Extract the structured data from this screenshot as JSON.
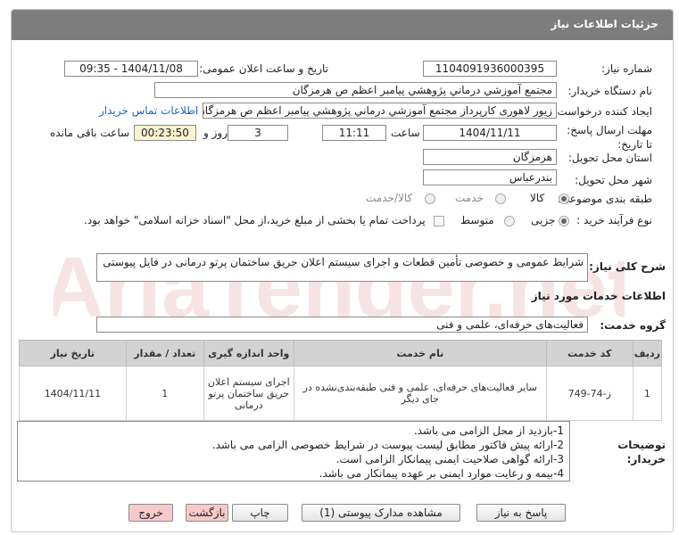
{
  "page_title": "جزئیات اطلاعات نیاز",
  "fields": {
    "need_number_label": "شماره نیاز:",
    "need_number": "1104091936000395",
    "announce_label": "تاریخ و ساعت اعلان عمومی:",
    "announce_value": "1404/11/08 - 09:35",
    "buyer_org_label": "نام دستگاه خریدار:",
    "buyer_org": "مجتمع آموزشي درماني پژوهشي پيامبر اعظم ص  هرمزگان",
    "requester_label": "ایجاد کننده درخواست:",
    "requester": "زیور لاهوری کارپرداز مجتمع آموزشي درماني پژوهشي پيامبر اعظم ص  هرمزگان",
    "contact_link": "اطلاعات تماس خریدار",
    "deadline_label": "مهلت ارسال پاسخ: تا تاریخ:",
    "deadline_date": "1404/11/11",
    "time_label": "ساعت",
    "deadline_time": "11:11",
    "days_value": "3",
    "days_label": "روز و",
    "remaining_time": "00:23:50",
    "remaining_label": "ساعت باقی مانده",
    "province_label": "استان محل تحویل:",
    "province": "هرمزگان",
    "city_label": "شهر محل تحویل:",
    "city": "بندرعباس",
    "category_label": "طبقه بندی موضوعی:",
    "category_options": [
      "کالا",
      "خدمت",
      "کالا/خدمت"
    ],
    "category_selected": "کالا",
    "purchase_type_label": "نوع فرآیند خرید :",
    "purchase_type_options": [
      "جزیی",
      "متوسط"
    ],
    "purchase_type_selected": "جزیی",
    "treasury_note": "پرداخت تمام یا بخشی از مبلغ خرید،از محل \"اسناد خزانه اسلامی\" خواهد بود."
  },
  "description": {
    "label": "شرح کلی نیاز:",
    "value": "شرایط عمومی و خصوصی تأمین قطعات و اجرای سیستم اعلان حریق ساختمان پرتو درمانی در فایل پیوستی"
  },
  "services_section_title": "اطلاعات خدمات مورد نیاز",
  "service_group": {
    "label": "گروه خدمت:",
    "value": "فعالیت‌های حرفه‌ای، علمی و فنی"
  },
  "table": {
    "headers": [
      "ردیف",
      "کد خدمت",
      "نام خدمت",
      "واحد اندازه گیری",
      "تعداد / مقدار",
      "تاریخ نیاز"
    ],
    "rows": [
      {
        "row": "1",
        "code": "ز-74-749",
        "name": "سایر فعالیت‌های حرفه‌ای، علمی و فنی طبقه‌بندی‌نشده در جای دیگر",
        "unit": "اجرای سیستم اعلان حریق ساختمان پرتو درمانی",
        "qty": "1",
        "date": "1404/11/11"
      }
    ]
  },
  "buyer_notes": {
    "label": "توضیحات خریدار:",
    "lines": [
      "1-بازدید از محل الزامی می باشد.",
      "2-ارائه پیش فاکتور مطابق لیست پیوست در شرایط خصوصی الزامی می باشد.",
      "3-ارائه گواهی صلاحیت ایمنی پیمانکار الزامی است.",
      "4-بیمه و رعایت موارد ایمنی بر عهده پیمانکار می باشد."
    ]
  },
  "buttons": {
    "reply": "پاسخ به نیاز",
    "attachments": "مشاهده مدارک پیوستی (1)",
    "print": "چاپ",
    "back": "بازگشت",
    "exit": "خروج"
  },
  "watermark_text": "AriaTender.net"
}
